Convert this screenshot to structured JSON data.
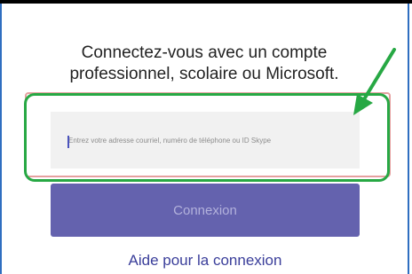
{
  "signin": {
    "heading": "Connectez-vous avec un compte professionnel, scolaire ou Microsoft.",
    "input_placeholder": "Entrez votre adresse courriel, numéro de téléphone ou ID Skype",
    "input_value": "",
    "signin_button": "Connexion",
    "help_link": "Aide pour la connexion"
  },
  "annotation": {
    "highlight_color": "#27a844",
    "arrow_color": "#27a844",
    "arrow_icon": "pointer-arrow-icon"
  },
  "colors": {
    "brand": "#6462ae",
    "field_background": "#f1f1f1",
    "field_border": "#e5a0a0",
    "frame": "#2f6ec0",
    "link": "#3a3e9a"
  }
}
